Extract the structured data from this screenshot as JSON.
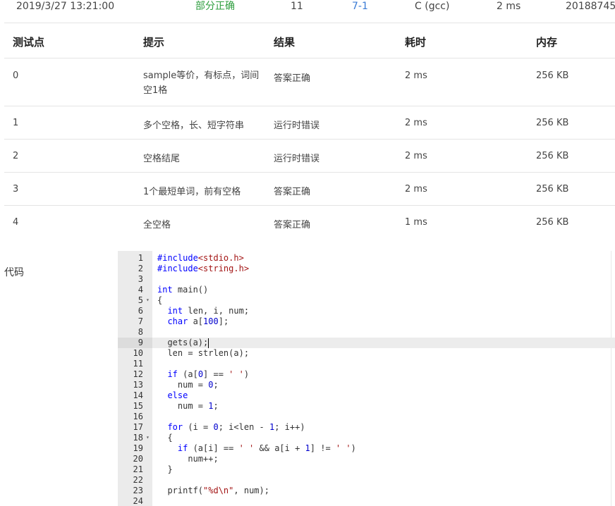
{
  "submission": {
    "time": "2019/3/27 13:21:00",
    "status": "部分正确",
    "score": "11",
    "problem": "7-1",
    "compiler": "C (gcc)",
    "duration": "2 ms",
    "user": "20188745"
  },
  "table": {
    "headers": [
      "测试点",
      "提示",
      "结果",
      "耗时",
      "内存"
    ],
    "rows": [
      {
        "id": "0",
        "hint": "sample等价，有标点，词间空1格",
        "result": "答案正确",
        "time": "2 ms",
        "memory": "256 KB"
      },
      {
        "id": "1",
        "hint": "多个空格，长、短字符串",
        "result": "运行时错误",
        "time": "2 ms",
        "memory": "256 KB"
      },
      {
        "id": "2",
        "hint": "空格结尾",
        "result": "运行时错误",
        "time": "2 ms",
        "memory": "256 KB"
      },
      {
        "id": "3",
        "hint": "1个最短单词，前有空格",
        "result": "答案正确",
        "time": "2 ms",
        "memory": "256 KB"
      },
      {
        "id": "4",
        "hint": "全空格",
        "result": "答案正确",
        "time": "1 ms",
        "memory": "256 KB"
      }
    ]
  },
  "code_section": {
    "label": "代码",
    "lines": [
      "#include<stdio.h>",
      "#include<string.h>",
      "",
      "int main()",
      "{",
      "  int len, i, num;",
      "  char a[100];",
      "",
      "  gets(a);",
      "  len = strlen(a);",
      "",
      "  if (a[0] == ' ')",
      "    num = 0;",
      "  else",
      "    num = 1;",
      "",
      "  for (i = 0; i<len - 1; i++)",
      "  {",
      "    if (a[i] == ' ' && a[i + 1] != ' ')",
      "      num++;",
      "  }",
      "",
      "  printf(\"%d\\n\", num);",
      ""
    ],
    "line_numbers": [
      "1",
      "2",
      "3",
      "4",
      "5",
      "6",
      "7",
      "8",
      "9",
      "10",
      "11",
      "12",
      "13",
      "14",
      "15",
      "16",
      "17",
      "18",
      "19",
      "20",
      "21",
      "22",
      "23",
      "24"
    ],
    "fold_lines": [
      5,
      18
    ],
    "active_line": 9
  },
  "colors": {
    "status_partial": "#2e9e3f",
    "problem_link": "#3a7bd5",
    "result_correct": "#e04a3c",
    "result_runtime_error": "#3ca33c",
    "gutter_bg": "#ebebeb"
  }
}
